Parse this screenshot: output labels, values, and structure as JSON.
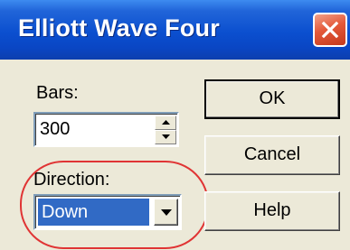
{
  "window": {
    "title": "Elliott Wave Four",
    "title_bar_color": "#0b4fcf",
    "close_button_color": "#e4593a",
    "close_icon": "close-icon"
  },
  "bars": {
    "label": "Bars:",
    "value": "300",
    "up_icon": "spin-up-icon",
    "down_icon": "spin-down-icon"
  },
  "direction": {
    "label": "Direction:",
    "selected": "Down",
    "dropdown_icon": "chevron-down-icon",
    "highlight_color": "#e03434"
  },
  "buttons": {
    "ok": "OK",
    "cancel": "Cancel",
    "help": "Help"
  }
}
